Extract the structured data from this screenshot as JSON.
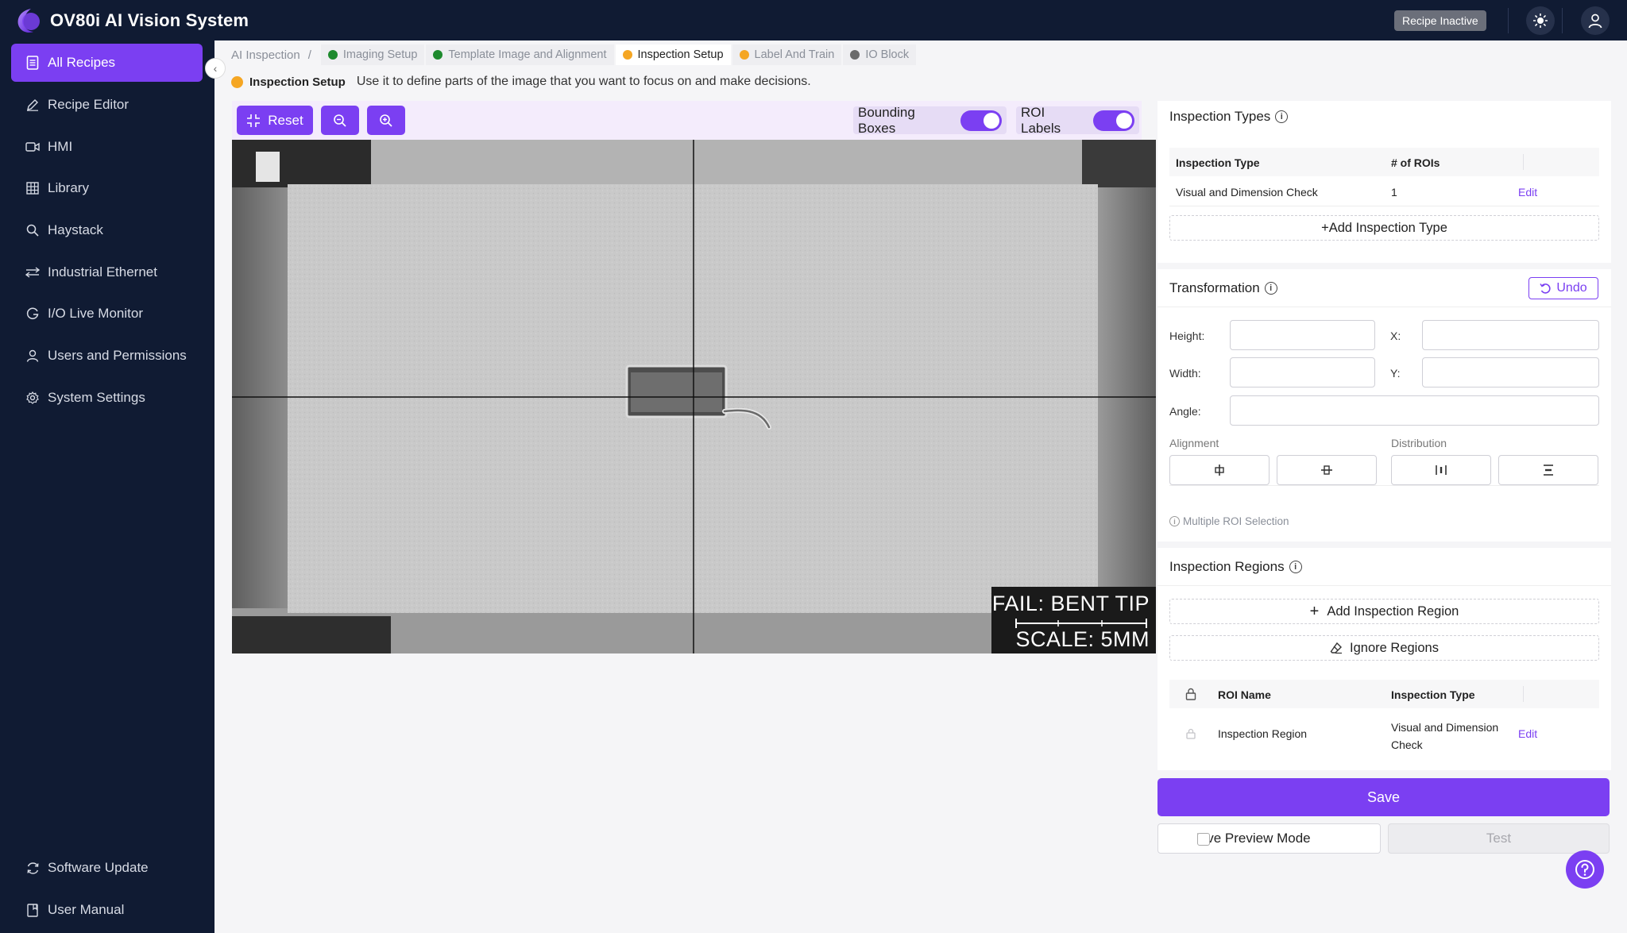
{
  "app": {
    "title": "OV80i AI Vision System",
    "recipe_status": "Recipe Inactive"
  },
  "sidebar": {
    "items": [
      {
        "label": "All Recipes",
        "icon": "document-icon"
      },
      {
        "label": "Recipe Editor",
        "icon": "pencil-icon"
      },
      {
        "label": "HMI",
        "icon": "video-icon"
      },
      {
        "label": "Library",
        "icon": "grid-icon"
      },
      {
        "label": "Haystack",
        "icon": "search-icon"
      },
      {
        "label": "Industrial Ethernet",
        "icon": "network-icon"
      },
      {
        "label": "I/O Live Monitor",
        "icon": "monitor-icon"
      },
      {
        "label": "Users and Permissions",
        "icon": "user-icon"
      },
      {
        "label": "System Settings",
        "icon": "gear-icon"
      }
    ],
    "footer": [
      {
        "label": "Software Update",
        "icon": "refresh-icon"
      },
      {
        "label": "User Manual",
        "icon": "book-icon"
      }
    ]
  },
  "breadcrumb": {
    "root": "AI Inspection",
    "separator": "/",
    "steps": [
      {
        "label": "Imaging Setup",
        "status_color": "#1e8a2e"
      },
      {
        "label": "Template Image and Alignment",
        "status_color": "#1e8a2e"
      },
      {
        "label": "Inspection Setup",
        "status_color": "#f5a623"
      },
      {
        "label": "Label And Train",
        "status_color": "#f5a623"
      },
      {
        "label": "IO Block",
        "status_color": "#6b6b6b"
      }
    ]
  },
  "section": {
    "name": "Inspection Setup",
    "description": "Use it to define parts of the image that you want to focus on and make decisions."
  },
  "toolbar": {
    "reset_label": "Reset",
    "bounding_boxes_label": "Bounding Boxes",
    "roi_labels_label": "ROI Labels",
    "bounding_boxes_on": true,
    "roi_labels_on": true
  },
  "image_overlay": {
    "result": "FAIL: BENT TIP",
    "scale": "SCALE: 5MM"
  },
  "inspection_types": {
    "title": "Inspection Types",
    "columns": [
      "Inspection Type",
      "# of ROIs"
    ],
    "rows": [
      {
        "type": "Visual and Dimension Check",
        "rois": "1",
        "action": "Edit"
      }
    ],
    "add_label": "+Add Inspection Type"
  },
  "transformation": {
    "title": "Transformation",
    "undo_label": "Undo",
    "height_label": "Height:",
    "width_label": "Width:",
    "x_label": "X:",
    "y_label": "Y:",
    "angle_label": "Angle:",
    "alignment_label": "Alignment",
    "distribution_label": "Distribution",
    "multi_roi_hint": "Multiple ROI Selection"
  },
  "inspection_regions": {
    "title": "Inspection Regions",
    "add_label": "Add Inspection Region",
    "ignore_label": "Ignore Regions",
    "columns": [
      "ROI Name",
      "Inspection Type"
    ],
    "rows": [
      {
        "name": "Inspection Region",
        "type_line1": "Visual and Dimension",
        "type_line2": "Check",
        "action": "Edit"
      }
    ]
  },
  "actions": {
    "save_label": "Save",
    "live_preview_label": "Live Preview Mode",
    "test_label": "Test"
  },
  "colors": {
    "accent": "#7b3ff2",
    "topbar": "#101b33"
  }
}
